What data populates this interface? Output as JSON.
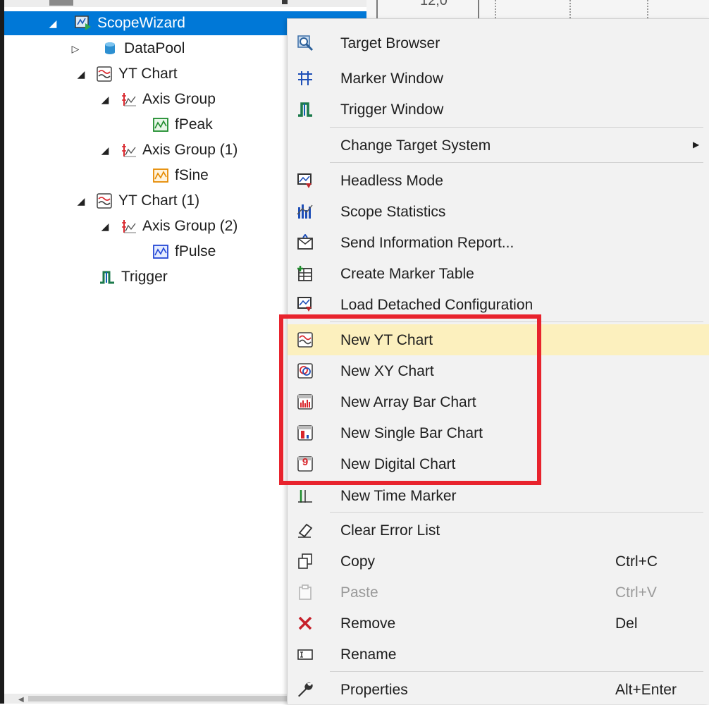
{
  "tree": {
    "items": [
      {
        "label": "ScopeWizard",
        "expander": "◢"
      },
      {
        "label": "DataPool",
        "expander": "▷"
      },
      {
        "label": "YT Chart",
        "expander": "◢"
      },
      {
        "label": "Axis Group",
        "expander": "◢"
      },
      {
        "label": "fPeak",
        "expander": ""
      },
      {
        "label": "Axis Group (1)",
        "expander": "◢"
      },
      {
        "label": "fSine",
        "expander": ""
      },
      {
        "label": "YT Chart (1)",
        "expander": "◢"
      },
      {
        "label": "Axis Group (2)",
        "expander": "◢"
      },
      {
        "label": "fPulse",
        "expander": ""
      },
      {
        "label": "Trigger",
        "expander": ""
      }
    ]
  },
  "background": {
    "header_value": "12,0"
  },
  "menu": {
    "items": [
      {
        "label": "Target Browser",
        "icon": "target-browser-icon"
      },
      {
        "label": "Marker Window",
        "icon": "marker-window-icon"
      },
      {
        "label": "Trigger Window",
        "icon": "trigger-window-icon"
      },
      {
        "label": "Change Target System",
        "icon": "",
        "submenu": "▶"
      },
      {
        "label": "Headless Mode",
        "icon": "headless-mode-icon"
      },
      {
        "label": "Scope Statistics",
        "icon": "scope-statistics-icon"
      },
      {
        "label": "Send Information Report...",
        "icon": "send-report-icon"
      },
      {
        "label": "Create Marker Table",
        "icon": "marker-table-icon"
      },
      {
        "label": "Load Detached Configuration",
        "icon": "load-config-icon"
      },
      {
        "label": "New YT Chart",
        "icon": "yt-chart-icon"
      },
      {
        "label": "New XY Chart",
        "icon": "xy-chart-icon"
      },
      {
        "label": "New Array Bar Chart",
        "icon": "array-bar-chart-icon"
      },
      {
        "label": "New Single Bar Chart",
        "icon": "single-bar-chart-icon"
      },
      {
        "label": "New Digital Chart",
        "icon": "digital-chart-icon",
        "glyph": "9"
      },
      {
        "label": "New Time Marker",
        "icon": "time-marker-icon"
      },
      {
        "label": "Clear Error List",
        "icon": "eraser-icon"
      },
      {
        "label": "Copy",
        "icon": "copy-icon",
        "shortcut": "Ctrl+C"
      },
      {
        "label": "Paste",
        "icon": "paste-icon",
        "shortcut": "Ctrl+V",
        "disabled": true
      },
      {
        "label": "Remove",
        "icon": "remove-icon",
        "shortcut": "Del"
      },
      {
        "label": "Rename",
        "icon": "rename-icon"
      },
      {
        "label": "Properties",
        "icon": "wrench-icon",
        "shortcut": "Alt+Enter"
      }
    ]
  },
  "colors": {
    "selection": "#0078d7",
    "hover": "#fcf0be",
    "highlight_box": "#e8232d",
    "menu_bg": "#f2f2f2"
  }
}
